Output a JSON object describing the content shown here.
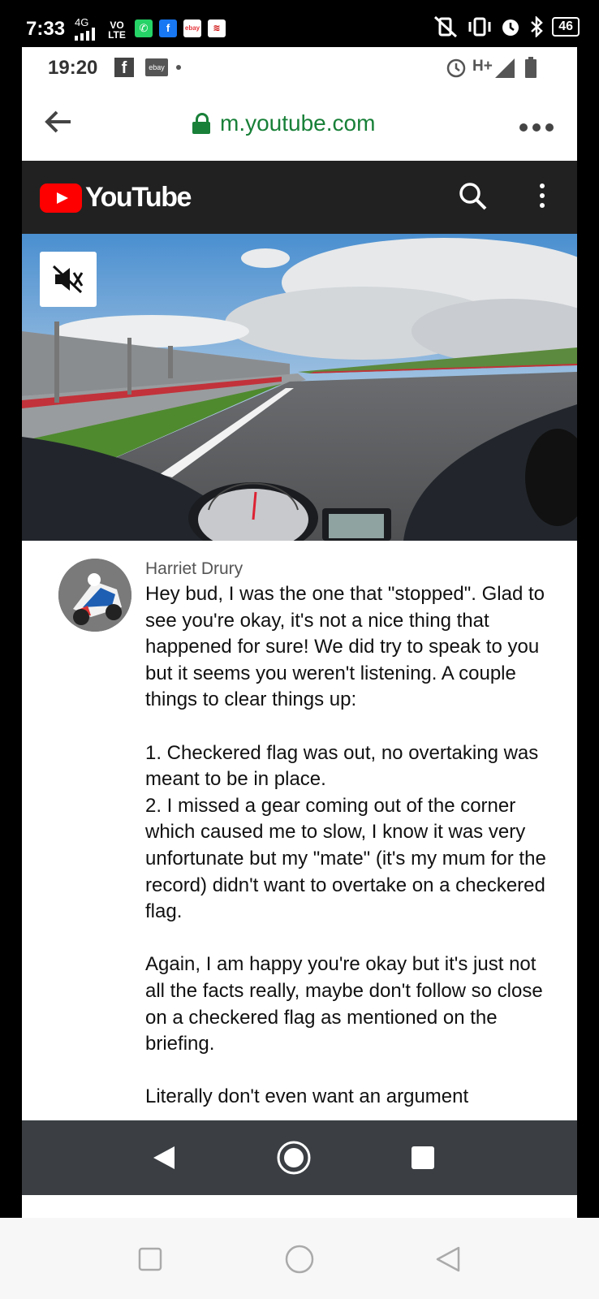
{
  "outer_status": {
    "time": "7:33",
    "network": "4G",
    "volte": "VO LTE",
    "battery": "46"
  },
  "inner_status": {
    "time": "19:20",
    "network": "H+"
  },
  "url_bar": {
    "url": "m.youtube.com"
  },
  "youtube": {
    "logo_text": "YouTube"
  },
  "comment": {
    "author": "Harriet Drury",
    "text": "Hey bud, I was the one that \"stopped\". Glad to see you're okay, it's not a nice thing that happened for sure! We did try to speak to you but it seems you weren't listening. A couple things to clear things up:\n\n1. Checkered flag was out, no overtaking was meant to be in place.\n2. I missed a gear coming out of the corner which caused me to slow, I know it was very unfortunate but my \"mate\" (it's my mum for the record) didn't want to overtake on a checkered flag.\n\nAgain, I am happy you're okay but it's just not all the facts really, maybe don't follow so close on a checkered flag as mentioned on the briefing.\n\nLiterally don't even want an argument"
  },
  "colors": {
    "url_green": "#188038",
    "youtube_red": "#ff0000",
    "yt_header_bg": "#212121",
    "nav_bar_bg": "#3b3f44"
  }
}
